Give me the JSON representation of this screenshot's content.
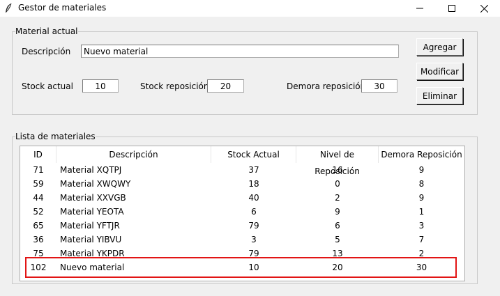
{
  "window": {
    "title": "Gestor de materiales",
    "icon": "feather-icon",
    "controls": [
      "minimize-icon",
      "maximize-icon",
      "close-icon"
    ]
  },
  "material_actual": {
    "legend": "Material actual",
    "descripcion_label": "Descripción",
    "descripcion_value": "Nuevo material",
    "stock_actual_label": "Stock actual",
    "stock_actual_value": "10",
    "stock_reposicion_label": "Stock reposición",
    "stock_reposicion_value": "20",
    "demora_label": "Demora reposición",
    "demora_value": "30"
  },
  "buttons": {
    "agregar": "Agregar",
    "modificar": "Modificar",
    "eliminar": "Eliminar"
  },
  "lista": {
    "legend": "Lista de materiales",
    "columns": [
      "ID",
      "Descripción",
      "Stock Actual",
      "Nivel de Reposición",
      "Demora Reposición"
    ],
    "rows": [
      [
        "71",
        "Material XQTPJ",
        "37",
        "16",
        "9"
      ],
      [
        "59",
        "Material XWQWY",
        "18",
        "0",
        "8"
      ],
      [
        "44",
        "Material XXVGB",
        "40",
        "2",
        "9"
      ],
      [
        "52",
        "Material YEOTA",
        "6",
        "9",
        "1"
      ],
      [
        "65",
        "Material YFTJR",
        "79",
        "6",
        "3"
      ],
      [
        "36",
        "Material YIBVU",
        "3",
        "5",
        "7"
      ],
      [
        "75",
        "Material YKPDR",
        "79",
        "13",
        "2"
      ],
      [
        "102",
        "Nuevo material",
        "10",
        "20",
        "30"
      ]
    ]
  },
  "colors": {
    "highlight": "#e21414",
    "window_bg": "#f0f0f0"
  }
}
